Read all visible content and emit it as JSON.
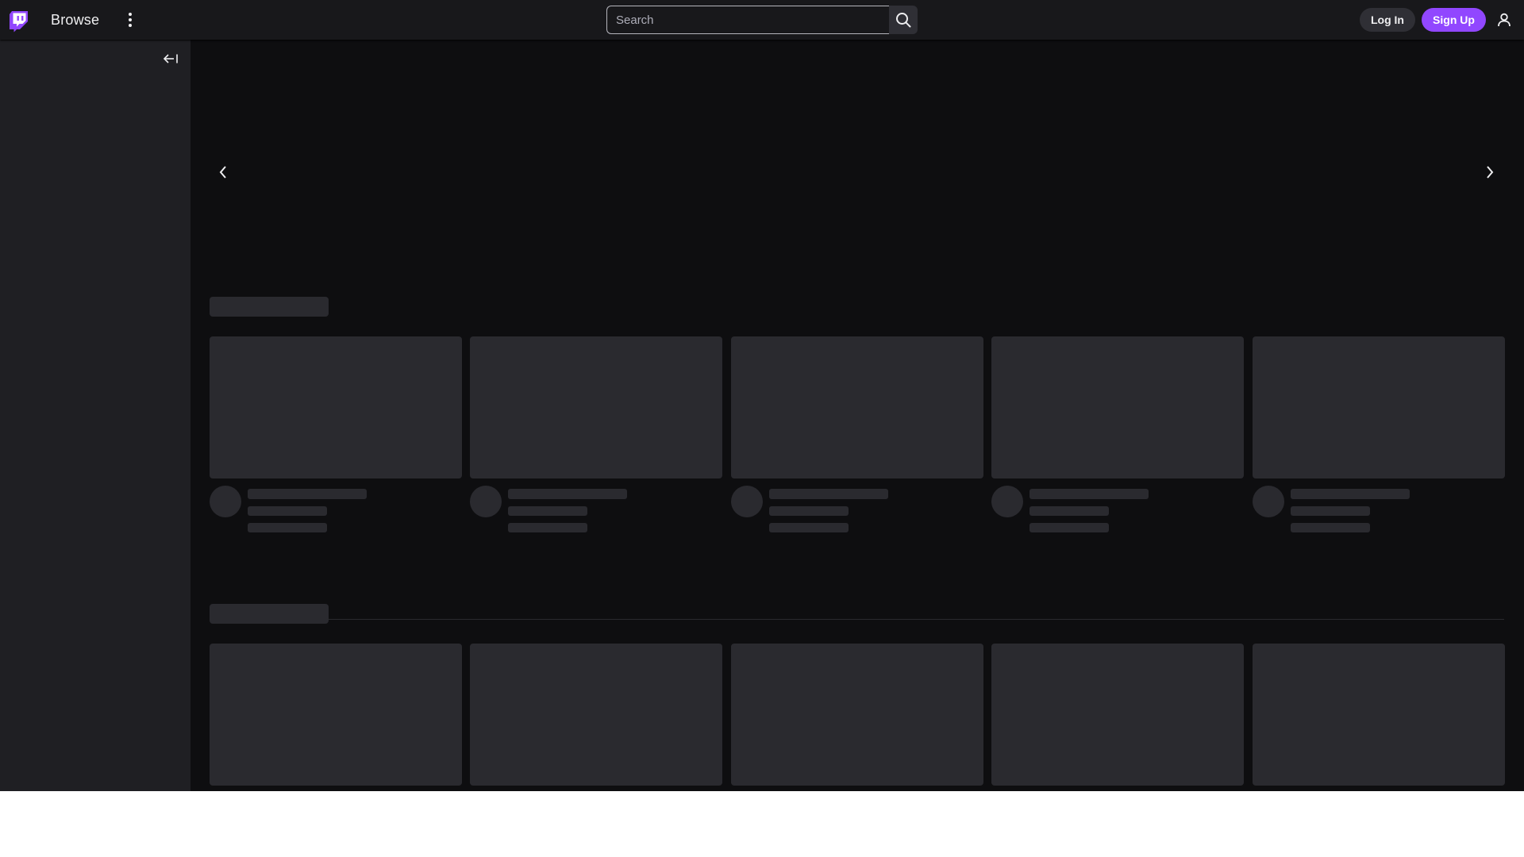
{
  "nav": {
    "logo_icon": "twitch-glitch-logo",
    "browse_label": "Browse",
    "more_icon": "vertical-dots-icon",
    "search_placeholder": "Search",
    "search_icon": "search-icon",
    "login_label": "Log In",
    "signup_label": "Sign Up",
    "user_icon": "user-icon"
  },
  "sidebar": {
    "collapse_icon": "collapse-left-arrow-icon"
  },
  "carousel": {
    "prev_icon": "chevron-left-icon",
    "next_icon": "chevron-right-icon"
  },
  "sections": [
    {
      "card_count": 5
    },
    {
      "card_count": 5
    }
  ],
  "colors": {
    "brand": "#9147ff",
    "background": "#0e0e10",
    "nav_background": "#18181b",
    "sidebar_background": "#1f1f23",
    "skeleton": "#2a2a2f"
  }
}
